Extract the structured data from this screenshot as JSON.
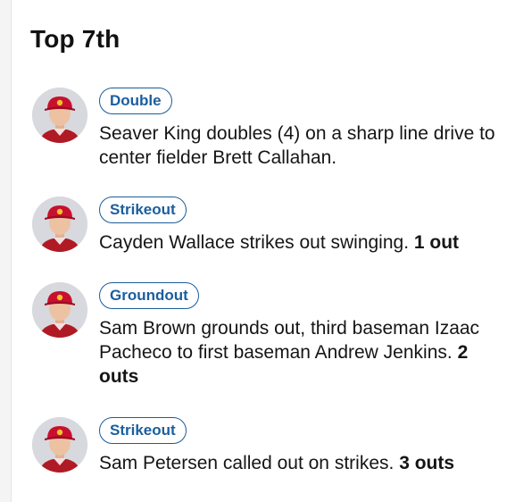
{
  "inning": {
    "title": "Top 7th"
  },
  "plays": [
    {
      "badge": "Double",
      "description": "Seaver King doubles (4) on a sharp line drive to center fielder Brett Callahan.",
      "outs": "",
      "player_icon": "player-headshot-avatar"
    },
    {
      "badge": "Strikeout",
      "description": "Cayden Wallace strikes out swinging.",
      "outs": "1 out",
      "player_icon": "player-headshot-avatar"
    },
    {
      "badge": "Groundout",
      "description": "Sam Brown grounds out, third baseman Izaac Pacheco to first baseman Andrew Jenkins.",
      "outs": "2 outs",
      "player_icon": "player-headshot-avatar"
    },
    {
      "badge": "Strikeout",
      "description": "Sam Petersen called out on strikes.",
      "outs": "3 outs",
      "player_icon": "player-headshot-avatar"
    }
  ],
  "colors": {
    "badge_text": "#1b5e9e",
    "badge_border": "#1a5c99",
    "cap_red": "#c8102e",
    "jersey_red": "#b01a24",
    "avatar_bg": "#d7d9de"
  }
}
